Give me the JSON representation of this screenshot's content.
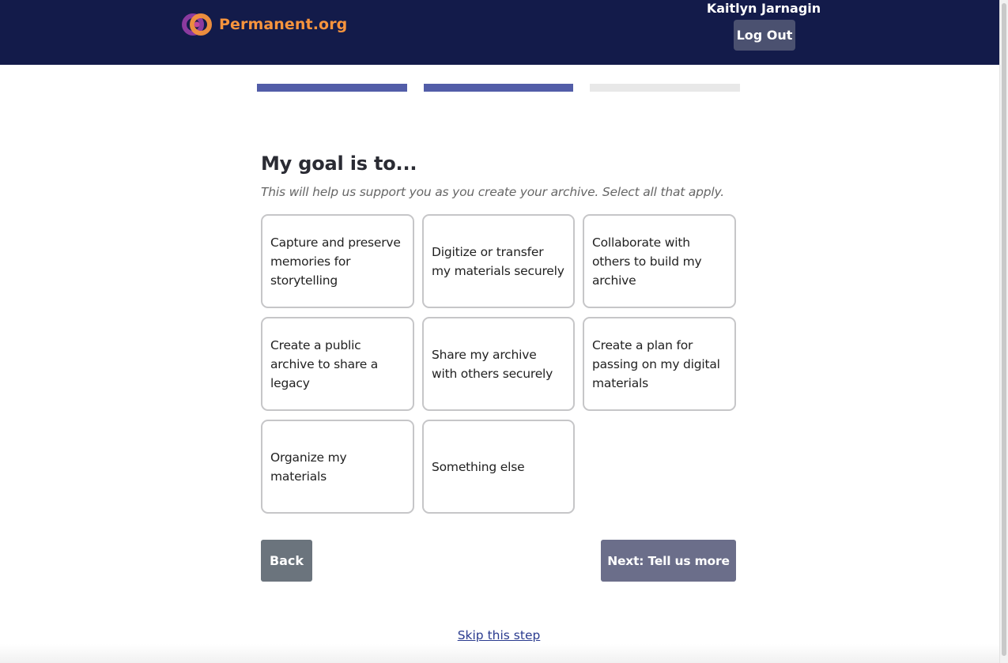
{
  "header": {
    "logo_text": "Permanent.org",
    "user_name": "Kaitlyn Jarnagin",
    "logout_label": "Log Out"
  },
  "progress": {
    "steps_total": 3,
    "steps_completed": 2
  },
  "main": {
    "title": "My goal is to...",
    "subtitle": "This will help us support you as you create your archive. Select all that apply.",
    "goals": [
      "Capture and preserve memories for storytelling",
      "Digitize or transfer my materials securely",
      "Collaborate with others to build my archive",
      "Create a public archive to share a legacy",
      "Share my archive with others securely",
      "Create a plan for passing on my digital materials",
      "Organize my materials",
      "Something else"
    ]
  },
  "actions": {
    "back_label": "Back",
    "next_label": "Next: Tell us more",
    "skip_label": "Skip this step"
  },
  "colors": {
    "header_bg": "#131b4a",
    "brand_orange": "#f7943d",
    "progress_done": "#525da8",
    "progress_todo": "#e8e8e8"
  }
}
